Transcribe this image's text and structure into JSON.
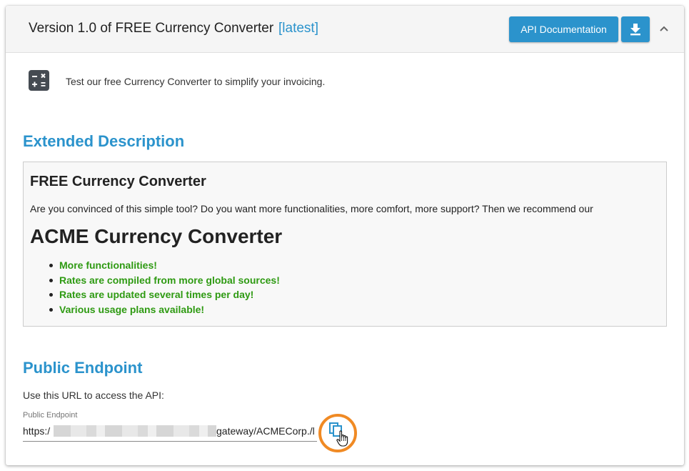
{
  "header": {
    "title": "Version 1.0 of FREE Currency Converter",
    "version_tag": "[latest]",
    "api_doc_label": "API Documentation",
    "download_icon": "download-icon",
    "collapse_icon": "chevron-up-icon"
  },
  "summary": {
    "icon": "calculator-icon",
    "text": "Test our free Currency Converter to simplify your invoicing."
  },
  "extended": {
    "title": "Extended Description",
    "heading": "FREE Currency Converter",
    "paragraph": "Are you convinced of this simple tool? Do you want more functionalities, more comfort, more support? Then we recommend our",
    "product": "ACME Currency Converter",
    "features": [
      "More functionalities!",
      "Rates are compiled from more global sources!",
      "Rates are updated several times per day!",
      "Various usage plans available!"
    ]
  },
  "endpoint": {
    "title": "Public Endpoint",
    "description": "Use this URL to access the API:",
    "field_label": "Public Endpoint",
    "url_prefix": "https:/",
    "url_suffix": "gateway/ACMECorp./l",
    "copy_icon": "copy-icon"
  },
  "colors": {
    "accent": "#2b93cc",
    "feature_green": "#2e9a12",
    "highlight_ring": "#f08a24"
  }
}
